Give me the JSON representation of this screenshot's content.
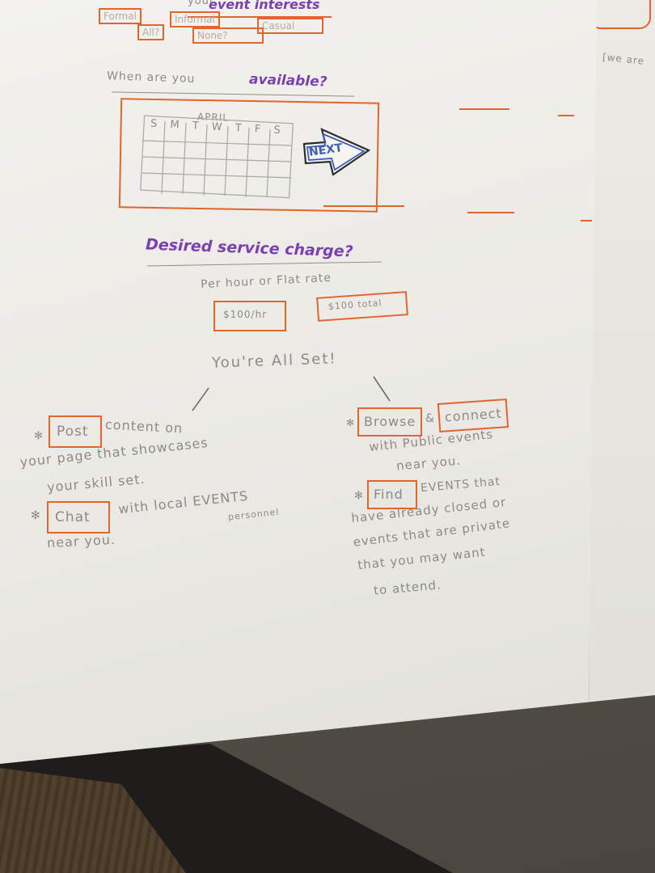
{
  "interests": {
    "title_prefix": "your",
    "title_label": "event interests",
    "chips": [
      "Formal",
      "Informal",
      "Casual",
      "All?",
      "None?"
    ]
  },
  "availability": {
    "question_prefix": "When are you",
    "question_emphasis": "available?",
    "month": "APRIL",
    "weekdays": "S M T W T F S",
    "next_label": "NEXT"
  },
  "rate": {
    "question": "Desired service charge?",
    "options_label": "Per hour or Flat rate",
    "hourly": "$100/hr",
    "flat": "$100 total"
  },
  "done": {
    "message": "You're All Set!"
  },
  "left_list": {
    "post_button": "Post",
    "post_text_1": "content on",
    "post_text_2": "your page that showcases",
    "post_text_3": "your skill set.",
    "chat_button": "Chat",
    "chat_text_1": "with local EVENTS",
    "chat_text_2": "near you.",
    "chat_note": "personnel"
  },
  "right_list": {
    "browse_button": "Browse",
    "connect_button": "connect",
    "browse_text_1": "with Public events",
    "browse_text_2": "near you.",
    "find_button": "Find",
    "find_text_1": "EVENTS that",
    "find_text_2": "have already closed or",
    "find_text_3": "events that are private",
    "find_text_4": "that you may want",
    "find_text_5": "to attend."
  },
  "side_sheet": {
    "note": "[we are"
  },
  "colors": {
    "marker_orange": "#e4642e",
    "marker_purple": "#7b3fb0",
    "pencil_gray": "#8c8a84",
    "marker_blue": "#3b5fb8"
  }
}
